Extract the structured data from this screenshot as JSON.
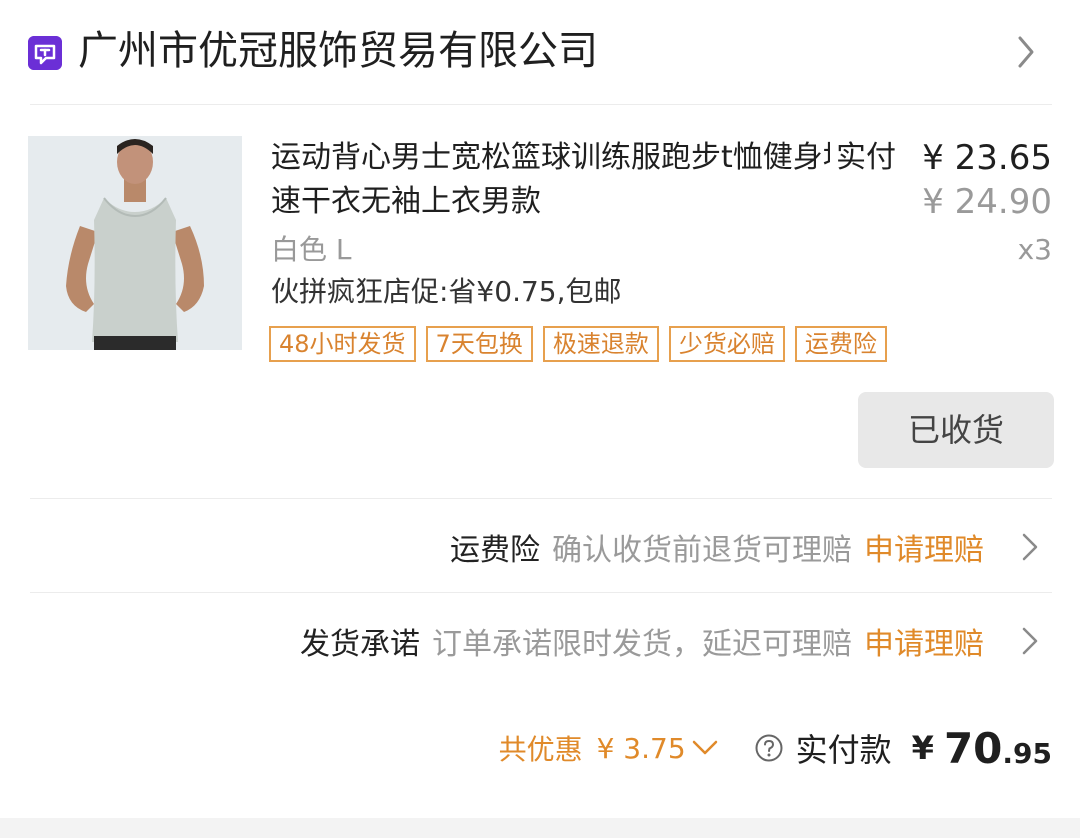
{
  "shop": {
    "name": "广州市优冠服饰贸易有限公司",
    "logo_color": "#6b2fd6"
  },
  "product": {
    "title": "运动背心男士宽松篮球训练服跑步t恤健身坎肩速干衣无袖上衣男款",
    "paid_label": "实付",
    "paid_price": "¥ 23.65",
    "original_price": "¥ 24.90",
    "sku": "白色 L",
    "quantity": "x3",
    "promo": "伙拼疯狂店促:省¥0.75,包邮",
    "tags": [
      "48小时发货",
      "7天包换",
      "极速退款",
      "少货必赔",
      "运费险"
    ]
  },
  "actions": {
    "received_label": "已收货"
  },
  "services": [
    {
      "title": "运费险",
      "description": "确认收货前退货可理赔",
      "action": "申请理赔"
    },
    {
      "title": "发货承诺",
      "description": "订单承诺限时发货，延迟可理赔",
      "action": "申请理赔"
    }
  ],
  "summary": {
    "discount_label": "共优惠",
    "discount_value": "¥ 3.75",
    "total_label": "实付款",
    "total_currency": "¥",
    "total_integer": "70",
    "total_decimal": ".95"
  },
  "colors": {
    "accent_orange": "#e08a2a",
    "tag_border": "#e7a04e",
    "muted_gray": "#9a9a9a",
    "button_gray": "#e8e8e8"
  },
  "icons": [
    "shop-logo-icon",
    "chevron-right-icon",
    "chevron-down-icon",
    "help-circle-icon"
  ]
}
